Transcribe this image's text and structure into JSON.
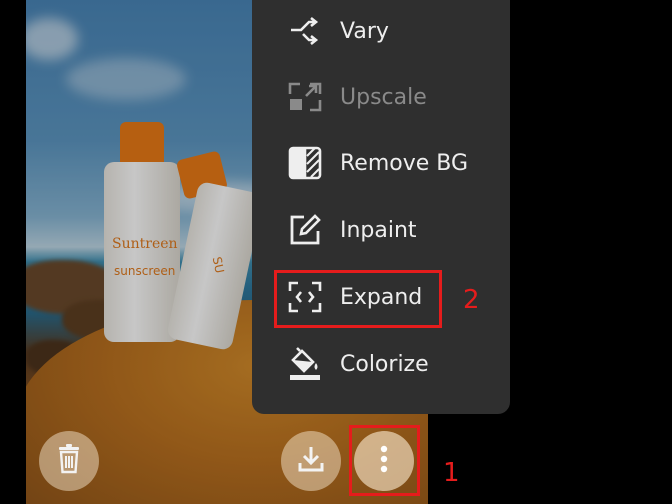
{
  "photo": {
    "brand_text": "Suntreen",
    "product_text": "sunscreen",
    "brand_text_2": "SU"
  },
  "menu": {
    "items": [
      {
        "label": "Vary",
        "icon": "vary-icon",
        "disabled": false
      },
      {
        "label": "Upscale",
        "icon": "upscale-icon",
        "disabled": true
      },
      {
        "label": "Remove BG",
        "icon": "remove-bg-icon",
        "disabled": false
      },
      {
        "label": "Inpaint",
        "icon": "inpaint-icon",
        "disabled": false
      },
      {
        "label": "Expand",
        "icon": "expand-icon",
        "disabled": false
      },
      {
        "label": "Colorize",
        "icon": "colorize-icon",
        "disabled": false
      }
    ]
  },
  "actions": {
    "delete_icon": "trash-icon",
    "download_icon": "download-icon",
    "more_icon": "more-vertical-icon"
  },
  "annotations": {
    "step_1": "1",
    "step_2": "2",
    "color": "#e51c1c"
  },
  "colors": {
    "menu_bg": "#2f2f2f",
    "menu_text": "#eeeeee",
    "disabled_text": "#8a8a8a",
    "accent_orange": "#ea7a17"
  }
}
